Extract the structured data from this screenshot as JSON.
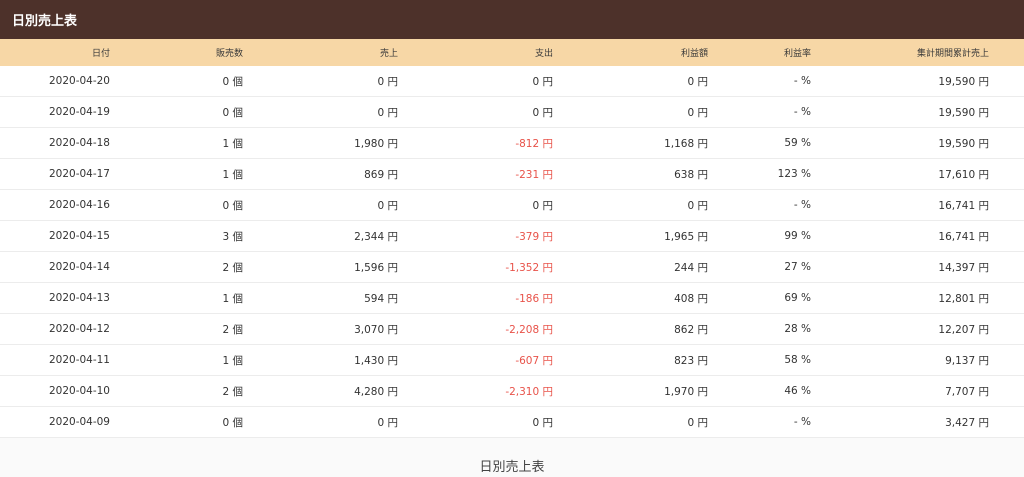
{
  "title": "日別売上表",
  "caption": "日別売上表",
  "headers": [
    "日付",
    "販売数",
    "売上",
    "支出",
    "利益額",
    "利益率",
    "集計期間累計売上"
  ],
  "rows": [
    {
      "date": "2020-04-20",
      "qty": "0 個",
      "sales": "0 円",
      "expense": "0 円",
      "profit": "0 円",
      "rate": "- %",
      "cum": "19,590 円",
      "neg": false
    },
    {
      "date": "2020-04-19",
      "qty": "0 個",
      "sales": "0 円",
      "expense": "0 円",
      "profit": "0 円",
      "rate": "- %",
      "cum": "19,590 円",
      "neg": false
    },
    {
      "date": "2020-04-18",
      "qty": "1 個",
      "sales": "1,980 円",
      "expense": "-812 円",
      "profit": "1,168 円",
      "rate": "59 %",
      "cum": "19,590 円",
      "neg": true
    },
    {
      "date": "2020-04-17",
      "qty": "1 個",
      "sales": "869 円",
      "expense": "-231 円",
      "profit": "638 円",
      "rate": "123 %",
      "cum": "17,610 円",
      "neg": true
    },
    {
      "date": "2020-04-16",
      "qty": "0 個",
      "sales": "0 円",
      "expense": "0 円",
      "profit": "0 円",
      "rate": "- %",
      "cum": "16,741 円",
      "neg": false
    },
    {
      "date": "2020-04-15",
      "qty": "3 個",
      "sales": "2,344 円",
      "expense": "-379 円",
      "profit": "1,965 円",
      "rate": "99 %",
      "cum": "16,741 円",
      "neg": true
    },
    {
      "date": "2020-04-14",
      "qty": "2 個",
      "sales": "1,596 円",
      "expense": "-1,352 円",
      "profit": "244 円",
      "rate": "27 %",
      "cum": "14,397 円",
      "neg": true
    },
    {
      "date": "2020-04-13",
      "qty": "1 個",
      "sales": "594 円",
      "expense": "-186 円",
      "profit": "408 円",
      "rate": "69 %",
      "cum": "12,801 円",
      "neg": true
    },
    {
      "date": "2020-04-12",
      "qty": "2 個",
      "sales": "3,070 円",
      "expense": "-2,208 円",
      "profit": "862 円",
      "rate": "28 %",
      "cum": "12,207 円",
      "neg": true
    },
    {
      "date": "2020-04-11",
      "qty": "1 個",
      "sales": "1,430 円",
      "expense": "-607 円",
      "profit": "823 円",
      "rate": "58 %",
      "cum": "9,137 円",
      "neg": true
    },
    {
      "date": "2020-04-10",
      "qty": "2 個",
      "sales": "4,280 円",
      "expense": "-2,310 円",
      "profit": "1,970 円",
      "rate": "46 %",
      "cum": "7,707 円",
      "neg": true
    },
    {
      "date": "2020-04-09",
      "qty": "0 個",
      "sales": "0 円",
      "expense": "0 円",
      "profit": "0 円",
      "rate": "- %",
      "cum": "3,427 円",
      "neg": false
    }
  ]
}
